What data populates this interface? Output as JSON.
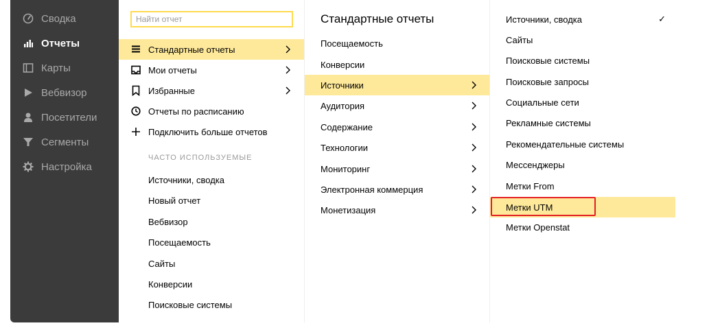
{
  "sidebar": {
    "items": [
      {
        "label": "Сводка",
        "icon": "gauge-icon"
      },
      {
        "label": "Отчеты",
        "icon": "bar-chart-icon",
        "active": true
      },
      {
        "label": "Карты",
        "icon": "map-icon"
      },
      {
        "label": "Вебвизор",
        "icon": "play-icon"
      },
      {
        "label": "Посетители",
        "icon": "user-icon"
      },
      {
        "label": "Сегменты",
        "icon": "filter-icon"
      },
      {
        "label": "Настройка",
        "icon": "gear-icon"
      }
    ]
  },
  "menu": {
    "search_placeholder": "Найти отчет",
    "items": [
      {
        "label": "Стандартные отчеты",
        "icon": "list-icon",
        "submenu": true,
        "highlighted": true
      },
      {
        "label": "Мои отчеты",
        "icon": "inbox-icon",
        "submenu": true
      },
      {
        "label": "Избранные",
        "icon": "bookmark-icon",
        "submenu": true
      },
      {
        "label": "Отчеты по расписанию",
        "icon": "clock-icon",
        "submenu": false
      },
      {
        "label": "Подключить больше отчетов",
        "icon": "plus-icon",
        "submenu": false
      }
    ],
    "frequent_title": "Часто используемые",
    "frequent": [
      "Источники, сводка",
      "Новый отчет",
      "Вебвизор",
      "Посещаемость",
      "Сайты",
      "Конверсии",
      "Поисковые системы"
    ]
  },
  "standard": {
    "title": "Стандартные отчеты",
    "items": [
      {
        "label": "Посещаемость",
        "submenu": false
      },
      {
        "label": "Конверсии",
        "submenu": false
      },
      {
        "label": "Источники",
        "submenu": true,
        "highlighted": true
      },
      {
        "label": "Аудитория",
        "submenu": true
      },
      {
        "label": "Содержание",
        "submenu": true
      },
      {
        "label": "Технологии",
        "submenu": true
      },
      {
        "label": "Мониторинг",
        "submenu": true
      },
      {
        "label": "Электронная коммерция",
        "submenu": true
      },
      {
        "label": "Монетизация",
        "submenu": true
      }
    ]
  },
  "sources": {
    "check_mark": "✓",
    "items": [
      {
        "label": "Источники, сводка",
        "checked": true
      },
      {
        "label": "Сайты"
      },
      {
        "label": "Поисковые системы"
      },
      {
        "label": "Поисковые запросы"
      },
      {
        "label": "Социальные сети"
      },
      {
        "label": "Рекламные системы"
      },
      {
        "label": "Рекомендательные системы"
      },
      {
        "label": "Мессенджеры"
      },
      {
        "label": "Метки From"
      },
      {
        "label": "Метки UTM",
        "highlighted": true,
        "outlined": true
      },
      {
        "label": "Метки Openstat"
      }
    ]
  },
  "colors": {
    "sidebar_bg": "#3b3b3b",
    "highlight": "#fee99b",
    "search_border": "#ffdb4d",
    "outline_red": "#e31e24"
  }
}
